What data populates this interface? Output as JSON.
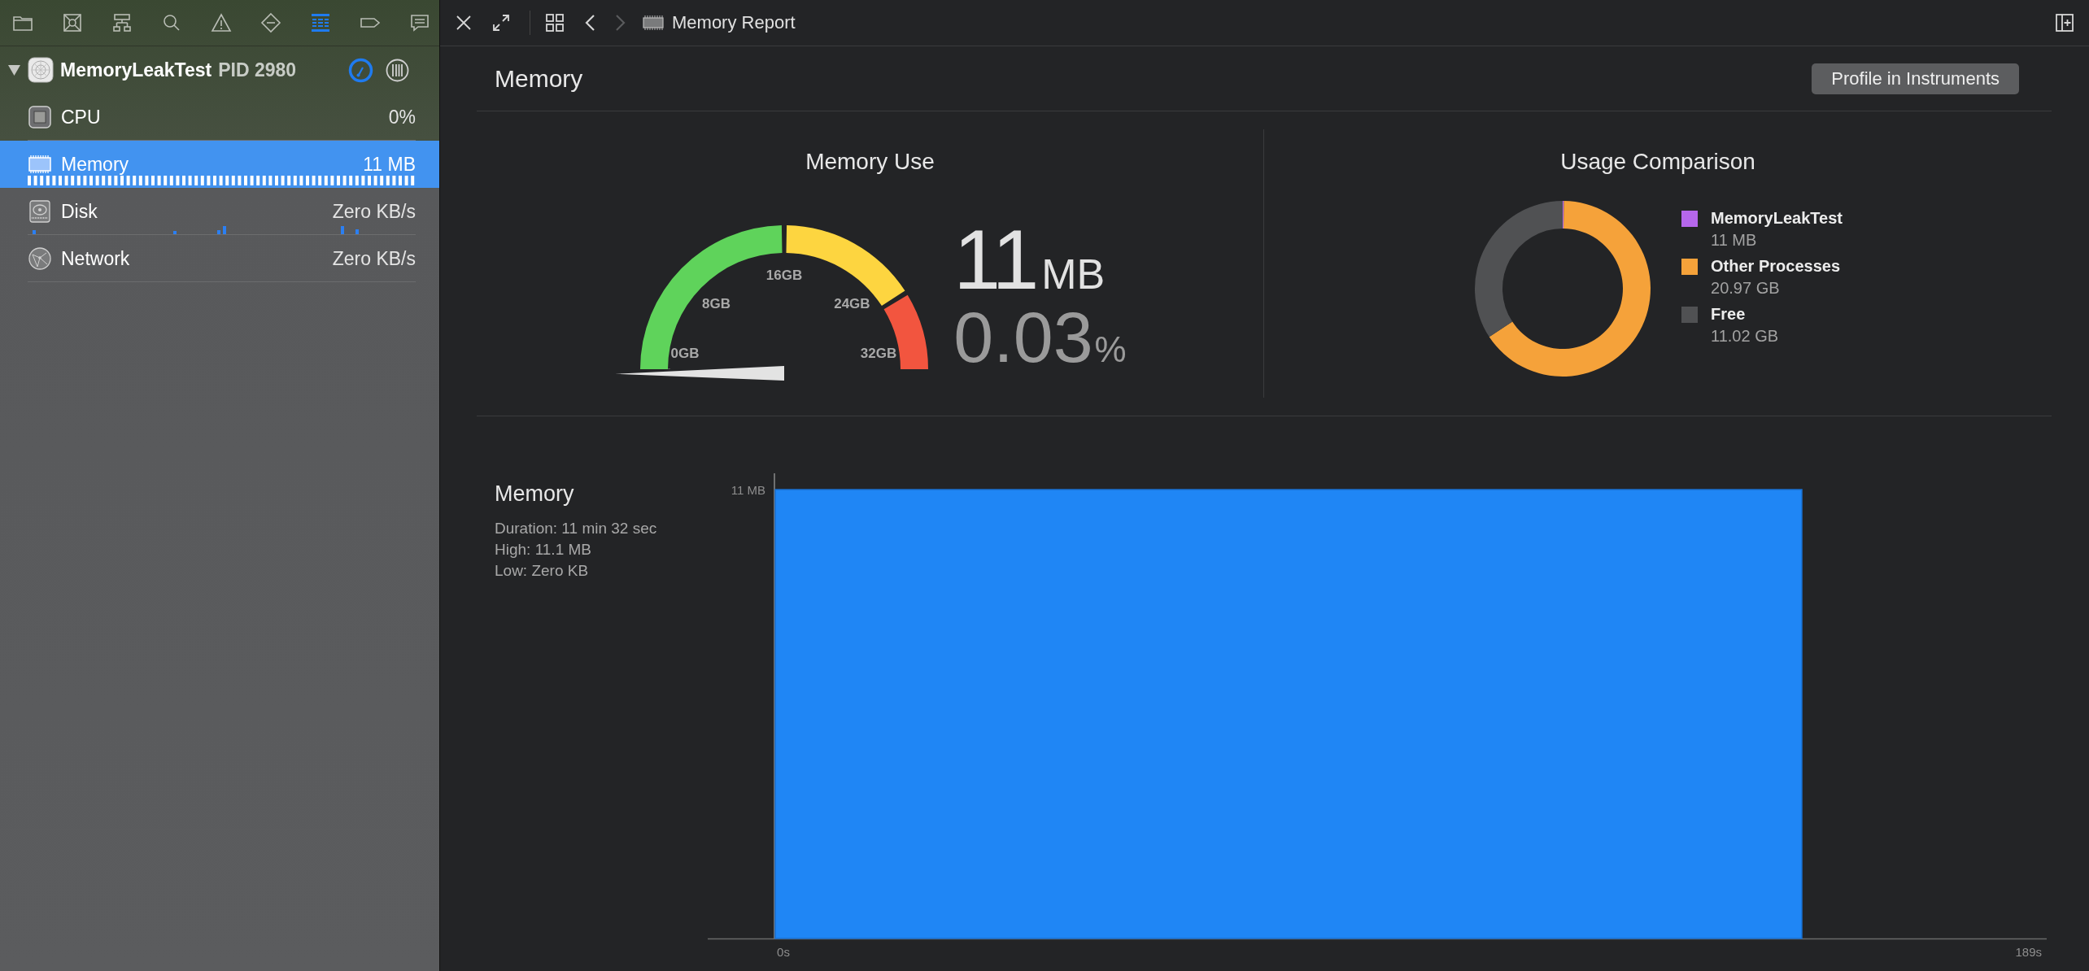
{
  "navigator_tabs": [
    {
      "kind": "folder",
      "selected": false
    },
    {
      "kind": "source-control",
      "selected": false
    },
    {
      "kind": "hierarchy",
      "selected": false
    },
    {
      "kind": "search",
      "selected": false
    },
    {
      "kind": "warning",
      "selected": false
    },
    {
      "kind": "breakpoint",
      "selected": false
    },
    {
      "kind": "debug",
      "selected": true
    },
    {
      "kind": "tag",
      "selected": false
    },
    {
      "kind": "report",
      "selected": false
    }
  ],
  "process": {
    "name": "MemoryLeakTest",
    "pid": "PID 2980",
    "expanded": true,
    "gauges": [
      {
        "kind": "cpu",
        "label": "CPU",
        "reading": "0%",
        "selected": false
      },
      {
        "kind": "memory",
        "label": "Memory",
        "reading": "11 MB",
        "selected": true
      },
      {
        "kind": "disk",
        "label": "Disk",
        "reading": "Zero KB/s",
        "selected": false
      },
      {
        "kind": "network",
        "label": "Network",
        "reading": "Zero KB/s",
        "selected": false
      }
    ]
  },
  "editor_bar": {
    "back": {
      "disabled": false
    },
    "forward": {
      "disabled": true
    },
    "title": "Memory Report"
  },
  "report": {
    "title": "Memory",
    "profile_button": "Profile in Instruments",
    "memory_use": {
      "title": "Memory Use",
      "gauge": {
        "level": 0.0003,
        "ticks": [
          "0GB",
          "8GB",
          "16GB",
          "24GB",
          "32GB"
        ]
      },
      "value": "11",
      "unit": "MB",
      "percent": "0.03",
      "percent_unit": "%"
    },
    "usage_comparison": {
      "title": "Usage Comparison",
      "legend": [
        {
          "reading": "11 MB",
          "color": "#b667ec"
        },
        {
          "reading": "20.97 GB",
          "color": "#f5a23a"
        },
        {
          "reading": "11.02 GB",
          "color": "#505153"
        }
      ],
      "chart_data": {
        "type": "donut",
        "categories": [
          "MemoryLeakTest",
          "Other Processes",
          "Free"
        ],
        "values": [
          0.03,
          65.53,
          34.44
        ]
      }
    },
    "timeline": {
      "title": "Memory",
      "stats": [
        "Duration: 11 min 32 sec",
        "High: 11.1 MB",
        "Low: Zero KB"
      ],
      "y_axis_label": "11 MB",
      "x_axis_labels": [
        "0s",
        "189s"
      ]
    }
  }
}
